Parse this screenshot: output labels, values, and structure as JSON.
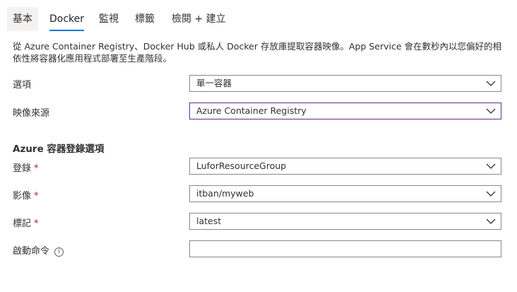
{
  "tabs": [
    {
      "label": "基本"
    },
    {
      "label": "Docker"
    },
    {
      "label": "監視"
    },
    {
      "label": "標籤"
    },
    {
      "label": "檢閱 + 建立"
    }
  ],
  "description": "從 Azure Container Registry、Docker Hub 或私人 Docker 存放庫提取容器映像。App Service 會在數秒內以您偏好的相依性將容器化應用程式部署至生產階段。",
  "fields": {
    "options": {
      "label": "選項",
      "value": "單一容器"
    },
    "image_source": {
      "label": "映像來源",
      "value": "Azure Container Registry"
    }
  },
  "acr_section": {
    "title": "Azure 容器登錄選項",
    "registry": {
      "label": "登錄",
      "required": "*",
      "value": "LuforResourceGroup"
    },
    "image": {
      "label": "影像",
      "required": "*",
      "value": "itban/myweb"
    },
    "tag": {
      "label": "標記",
      "required": "*",
      "value": "latest"
    },
    "startup_command": {
      "label": "啟動命令",
      "value": "",
      "info_icon": "i"
    }
  },
  "colors": {
    "accent": "#0078d4",
    "focus_border": "#5c2d91",
    "required": "#a4262c",
    "border": "#8a8886"
  },
  "icons": {
    "dropdown": "chevron-down-icon",
    "info": "info-icon"
  }
}
